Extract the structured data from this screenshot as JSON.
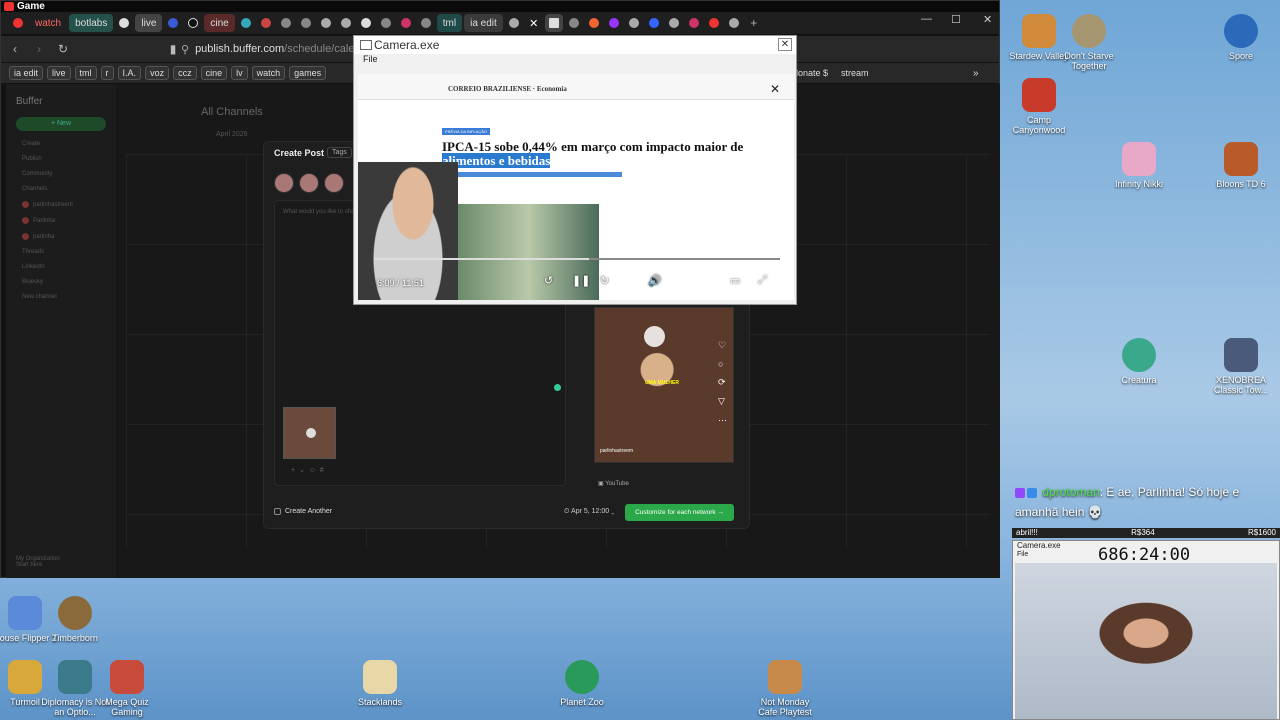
{
  "window": {
    "title": "Game"
  },
  "tabs": [
    {
      "label": "watch",
      "color": "#e33"
    },
    {
      "label": "botlabs",
      "color": "#4a8"
    },
    {
      "label": "live",
      "color": "#777"
    },
    {
      "label": "cine",
      "color": "#d55"
    },
    {
      "label": "tml",
      "color": "#4a8"
    },
    {
      "label": "ia edit",
      "color": "#555"
    }
  ],
  "address": {
    "url": "publish.buffer.com",
    "path": "/schedule/calend"
  },
  "bookmarks": [
    "ia edit",
    "live",
    "tml",
    "r",
    "I.A.",
    "voz",
    "ccz",
    "cine",
    "lv",
    "watch",
    "games"
  ],
  "bookmarks_right": {
    "donate": "lonate $",
    "stream": "stream"
  },
  "buffer": {
    "logo": "Buffer",
    "new_btn": "+ New",
    "channels_title": "All Channels",
    "date_label": "April 2026",
    "sidebar_items": [
      "Create",
      "Publish",
      "Community",
      "Channels",
      "parlinhastreem",
      "Parlinha",
      "parlinha",
      "Threads",
      "LinkedIn",
      "Bluesky",
      "New channel"
    ],
    "org": "My Organization",
    "help": "Start here"
  },
  "modal": {
    "title": "Create Post",
    "tags": "Tags",
    "placeholder": "What would you like to share?",
    "create_another": "Create Another",
    "schedule": "Apr 5, 12:00",
    "customize": "Customize for each network →",
    "youtube": "YouTube",
    "preview_caption": "UMA MULHER",
    "preview_handle": "parlinhastreem"
  },
  "camera": {
    "title": "Camera.exe",
    "menu": "File",
    "brand": "CORREIO BRAZILIENSE · Economia",
    "tagline": "PRÉVIA DA INFLAÇÃO",
    "headline_plain": "IPCA-15 sobe 0,44% em março com impacto maior de ",
    "headline_highlight": "alimentos e bebidas",
    "time": "6:09 / 11:51",
    "progress": 0.53
  },
  "desktop": {
    "icons_right": [
      {
        "label": "Stardew Valley"
      },
      {
        "label": "Don't Starve Together"
      },
      {
        "label": "Spore"
      },
      {
        "label": "Camp Canyonwood"
      },
      {
        "label": "Infinity Nikki"
      },
      {
        "label": "Bloons TD 6"
      },
      {
        "label": "Creatura"
      },
      {
        "label": "XENOBREA Classic Tow..."
      }
    ],
    "icons_bottom": [
      {
        "label": "House Flipper 2"
      },
      {
        "label": "Timberborn"
      },
      {
        "label": "Turmoil"
      },
      {
        "label": "Diplomacy is Not an Optio..."
      },
      {
        "label": "Mega Quiz Gaming"
      },
      {
        "label": "Stacklands"
      },
      {
        "label": "Planet Zoo"
      },
      {
        "label": "Not Monday Cafe Playtest"
      }
    ]
  },
  "chat": {
    "user": "dprotoman",
    "message": ": E ae, Parlinha! Só hoje e amanhã hein"
  },
  "goal": {
    "left": "abril!!!",
    "mid": "R$364",
    "right": "R$1600"
  },
  "cam2": {
    "title": "Camera.exe",
    "menu": "File",
    "timer": "686:24:00"
  }
}
